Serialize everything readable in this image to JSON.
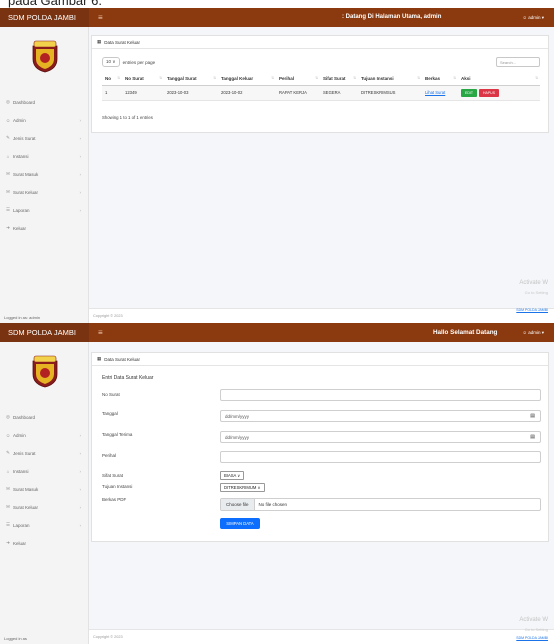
{
  "caption": "pada Gambar 6.",
  "brand": "SDM POLDA JAMBI",
  "menu_toggle": "≡",
  "screen1": {
    "welcome": ": Datang Di Halaman Utama, admin",
    "user": "admin ▾",
    "card_title": "Data Surat Keluar",
    "length_value": "10 ∨",
    "length_suffix": "entries per page",
    "search_placeholder": "Search...",
    "columns": [
      "No",
      "No Surat",
      "Tanggal Surat",
      "Tanggal Keluar",
      "Perihal",
      "Sifat Surat",
      "Tujuan Instansi",
      "Berkas",
      "Aksi"
    ],
    "rows": [
      {
        "no": "1",
        "no_surat": "12349",
        "tanggal_surat": "2023-10-03",
        "tanggal_keluar": "2023-10-02",
        "perihal": "RAPAT KERJA",
        "sifat": "SEGERA",
        "tujuan": "DITRESKRIMSUS",
        "berkas": "Lihat Surat",
        "edit": "EDIT",
        "hapus": "HAPUS"
      }
    ],
    "info": "Showing 1 to 1 of 1 entries",
    "copyright": "Copyright © 2023",
    "activate1": "Activate W",
    "activate2": "Go to Setting",
    "activate3": "SDM POLDA JAMBI",
    "logged": "Logged in as: admin"
  },
  "screen2": {
    "welcome": "Hallo Selamat Datang",
    "user": "admin ▾",
    "card_title": "Data Surat Keluar",
    "form_title": "Entri Data Surat Keluar",
    "labels": {
      "no_surat": "No Surat",
      "tanggal": "Tanggal",
      "tanggal_terima": "Tanggal Terima",
      "perihal": "Perihal",
      "sifat": "Sifat Surat",
      "tujuan": "Tujuan Instansi",
      "berkas": "Berkas PDF"
    },
    "date_placeholder": "dd/mm/yyyy",
    "sifat_value": "BIASA ∨",
    "tujuan_value": "DITRESKRIMUM ∨",
    "choose_file": "Choose file",
    "no_file": "No file chosen",
    "save_label": "SIMPAN DATA",
    "copyright": "Copyright © 2023",
    "activate1": "Activate W",
    "activate2": "Go to Setting",
    "activate3": "SDM POLDA JAMBI",
    "logged": "Logged in as"
  },
  "menu": [
    {
      "icon": "dashboard-icon",
      "glyph": "◎",
      "label": "Dashboard",
      "has_children": false
    },
    {
      "icon": "user-icon",
      "glyph": "☺",
      "label": "Admin",
      "has_children": true
    },
    {
      "icon": "tag-icon",
      "glyph": "✎",
      "label": "Jenis Surat",
      "has_children": true
    },
    {
      "icon": "building-icon",
      "glyph": "⌂",
      "label": "Instansi",
      "has_children": true
    },
    {
      "icon": "inbox-icon",
      "glyph": "✉",
      "label": "Surat Masuk",
      "has_children": true
    },
    {
      "icon": "outbox-icon",
      "glyph": "✉",
      "label": "Surat Keluar",
      "has_children": true
    },
    {
      "icon": "report-icon",
      "glyph": "☰",
      "label": "Laporan",
      "has_children": true
    },
    {
      "icon": "logout-icon",
      "glyph": "➜",
      "label": "Keluar",
      "has_children": false
    }
  ],
  "colors": {
    "topbar": "#8b3a0f",
    "edit": "#28a745",
    "hapus": "#dc3545",
    "save": "#0d6efd"
  }
}
